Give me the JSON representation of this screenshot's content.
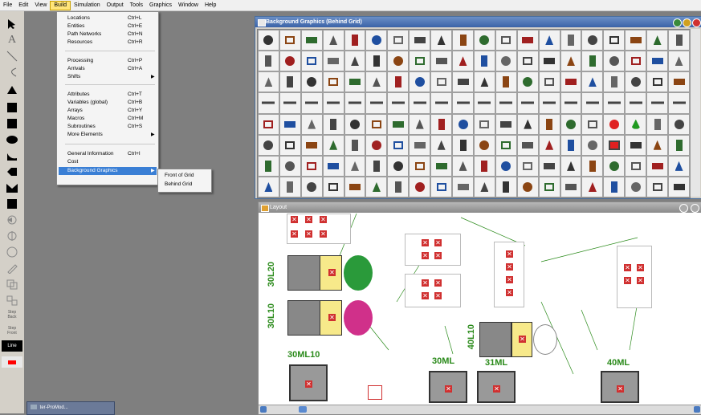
{
  "menubar": {
    "items": [
      {
        "label": "File"
      },
      {
        "label": "Edit"
      },
      {
        "label": "View"
      },
      {
        "label": "Build",
        "active": true
      },
      {
        "label": "Simulation"
      },
      {
        "label": "Output"
      },
      {
        "label": "Tools"
      },
      {
        "label": "Graphics"
      },
      {
        "label": "Window"
      },
      {
        "label": "Help"
      }
    ]
  },
  "build_menu": {
    "items": [
      {
        "label": "Locations",
        "shortcut": "Ctrl+L"
      },
      {
        "label": "Entities",
        "shortcut": "Ctrl+E"
      },
      {
        "label": "Path Networks",
        "shortcut": "Ctrl+N"
      },
      {
        "label": "Resources",
        "shortcut": "Ctrl+R"
      },
      {
        "label": "Processing",
        "shortcut": "Ctrl+P"
      },
      {
        "label": "Arrivals",
        "shortcut": "Ctrl+A"
      },
      {
        "label": "Shifts",
        "shortcut": "",
        "submenu": true
      },
      {
        "label": "Attributes",
        "shortcut": "Ctrl+T"
      },
      {
        "label": "Variables (global)",
        "shortcut": "Ctrl+B"
      },
      {
        "label": "Arrays",
        "shortcut": "Ctrl+Y"
      },
      {
        "label": "Macros",
        "shortcut": "Ctrl+M"
      },
      {
        "label": "Subroutines",
        "shortcut": "Ctrl+S"
      },
      {
        "label": "More Elements",
        "shortcut": "",
        "submenu": true
      },
      {
        "label": "General Information",
        "shortcut": "Ctrl+I"
      },
      {
        "label": "Cost",
        "shortcut": ""
      },
      {
        "label": "Background Graphics",
        "shortcut": "",
        "submenu": true,
        "highlighted": true
      }
    ],
    "submenu": {
      "items": [
        {
          "label": "Front of Grid"
        },
        {
          "label": "Behind Grid"
        }
      ]
    }
  },
  "toolbar": {
    "labels": {
      "step_back": "Step\nBack",
      "step_front": "Step\nFront",
      "line": "Line"
    },
    "accent_red": "#ff0000"
  },
  "bg_window": {
    "title": "Background Graphics (Behind Grid)"
  },
  "layout_window": {
    "title": "Layout",
    "labels": {
      "l1": "30L20",
      "l2": "30L10",
      "l3": "30ML10",
      "l4": "40L10",
      "l5": "30ML",
      "l6": "31ML",
      "l7": "40ML"
    }
  },
  "taskbar": {
    "label": "ter-ProMod..."
  },
  "colors": {
    "accent_highlight": "#3a7fd5",
    "menu_active": "#ffe57a",
    "grid_green": "#2a8a1a",
    "box_red": "#d03030"
  }
}
